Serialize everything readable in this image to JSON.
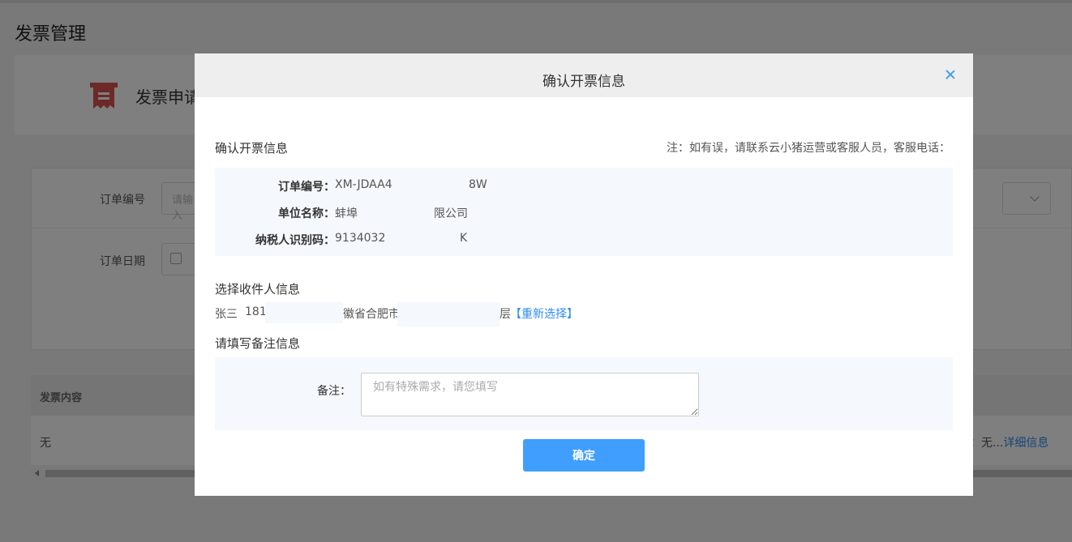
{
  "page": {
    "title": "发票管理",
    "card_title": "发票申请",
    "filters": {
      "order_no_label": "订单编号",
      "order_no_placeholder": "请输入",
      "order_date_label": "订单日期"
    },
    "table": {
      "col_invoice_content": "发票内容",
      "row_invoice_content": "无",
      "row_right_prefix": "：无...",
      "row_detail_link": "详细信息"
    }
  },
  "modal": {
    "title": "确认开票信息",
    "section_invoice": "确认开票信息",
    "note": "注：如有误，请联系云小猪运营或客服人员，客服电话：",
    "invoice_info": {
      "order_no_label": "订单编号：",
      "order_no_value": "XM-JDAA4",
      "order_no_tail": "8W",
      "company_label": "单位名称：",
      "company_value": "蚌埠",
      "company_tail": "限公司",
      "tax_id_label": "纳税人识别码：",
      "tax_id_value": "9134032",
      "tax_id_tail": "K"
    },
    "section_recipient": "选择收件人信息",
    "recipient": {
      "name": "张三",
      "phone": "181",
      "address_mid": "徽省合肥市",
      "address_tail": "层",
      "reselect_link": "【重新选择】"
    },
    "section_remark": "请填写备注信息",
    "remark": {
      "label": "备注：",
      "placeholder": "如有特殊需求，请您填写",
      "value": ""
    },
    "confirm_button": "确定"
  },
  "colors": {
    "accent": "#409eff",
    "link": "#2d8cf0",
    "info_bg": "#f5f8fc",
    "icon_red": "#d9534f"
  }
}
